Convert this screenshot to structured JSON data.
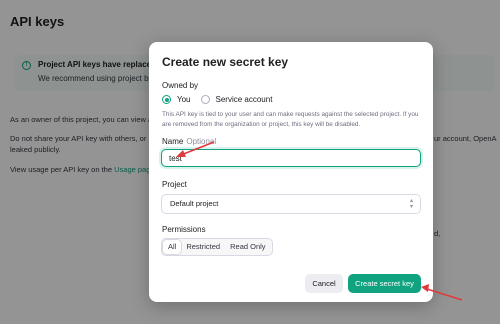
{
  "background": {
    "title": "API keys",
    "banner_title": "Project API keys have replaced u",
    "banner_sub": "We recommend using project ba",
    "line1": "As an owner of this project, you can view a",
    "line2a": "Do not share your API key with others, or",
    "line2b": "leaked publicly.",
    "line3_prefix": "View usage per API key on the ",
    "line3_link": "Usage pag",
    "right1": "ur account, OpenA",
    "right2": "d,"
  },
  "modal": {
    "title": "Create new secret key",
    "owned_by_label": "Owned by",
    "owner_options": [
      "You",
      "Service account"
    ],
    "owner_selected": "You",
    "description": "This API key is tied to your user and can make requests against the selected project. If you are removed from the organization or project, this key will be disabled.",
    "name_label": "Name",
    "name_optional": "Optional",
    "name_value": "test",
    "project_label": "Project",
    "project_value": "Default project",
    "permissions_label": "Permissions",
    "permissions": [
      "All",
      "Restricted",
      "Read Only"
    ],
    "permission_selected": "All",
    "cancel_label": "Cancel",
    "create_label": "Create secret key"
  },
  "colors": {
    "accent": "#10a37f",
    "annotation_arrow": "#e0393e"
  },
  "icons": {
    "info": "info-circle-icon",
    "caret": "up-down-caret-icon",
    "annotation": "red-arrow-icon"
  }
}
